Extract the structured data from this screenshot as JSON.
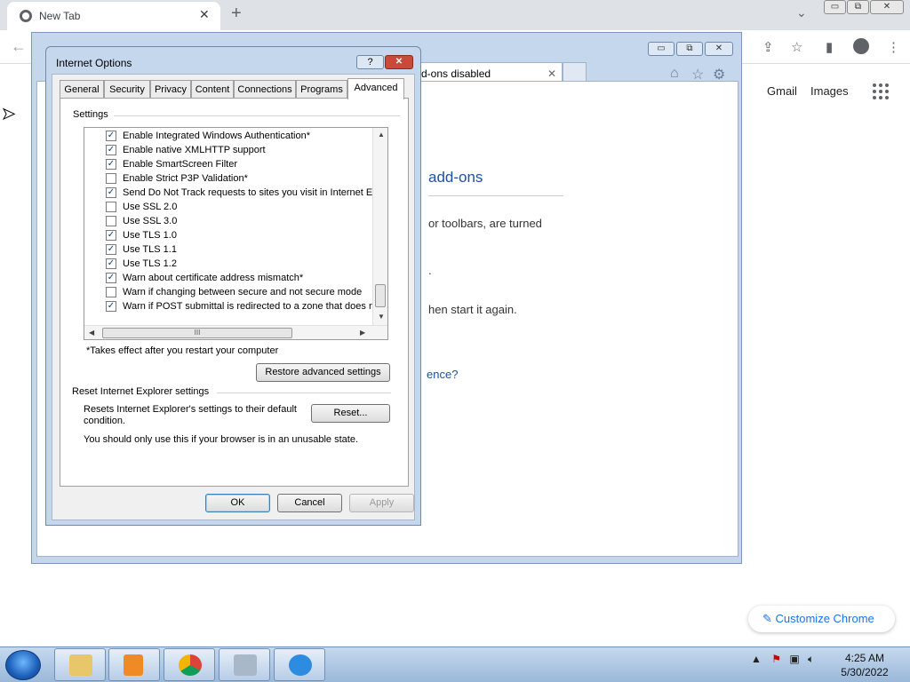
{
  "chrome": {
    "tab_title": "New Tab",
    "tab_close": "✕",
    "new_tab": "+",
    "gmail": "Gmail",
    "images": "Images",
    "customize": "Customize Chrome",
    "win_min": "▭",
    "win_max": "⧉",
    "win_close": "✕"
  },
  "ie": {
    "tab_title": "d-ons disabled",
    "tab_close": "✕",
    "heading": "add-ons",
    "line1": "or toolbars, are turned",
    "line2": ".",
    "line3": "hen start it again.",
    "link": "ence?"
  },
  "dialog": {
    "title": "Internet Options",
    "help": "?",
    "close": "✕",
    "tabs": [
      "General",
      "Security",
      "Privacy",
      "Content",
      "Connections",
      "Programs",
      "Advanced"
    ],
    "active_tab": "Advanced",
    "settings_label": "Settings",
    "items": [
      {
        "label": "Enable Integrated Windows Authentication*",
        "checked": true
      },
      {
        "label": "Enable native XMLHTTP support",
        "checked": true
      },
      {
        "label": "Enable SmartScreen Filter",
        "checked": true
      },
      {
        "label": "Enable Strict P3P Validation*",
        "checked": false
      },
      {
        "label": "Send Do Not Track requests to sites you visit in Internet E",
        "checked": true
      },
      {
        "label": "Use SSL 2.0",
        "checked": false
      },
      {
        "label": "Use SSL 3.0",
        "checked": false
      },
      {
        "label": "Use TLS 1.0",
        "checked": true
      },
      {
        "label": "Use TLS 1.1",
        "checked": true
      },
      {
        "label": "Use TLS 1.2",
        "checked": true
      },
      {
        "label": "Warn about certificate address mismatch*",
        "checked": true
      },
      {
        "label": "Warn if changing between secure and not secure mode",
        "checked": false
      },
      {
        "label": "Warn if POST submittal is redirected to a zone that does n",
        "checked": true
      }
    ],
    "hscroll_grip": "III",
    "restart_note": "*Takes effect after you restart your computer",
    "restore_btn": "Restore advanced settings",
    "reset_group": "Reset Internet Explorer settings",
    "reset_desc": "Resets Internet Explorer's settings to their default condition.",
    "reset_btn": "Reset...",
    "unusable_note": "You should only use this if your browser is in an unusable state.",
    "ok": "OK",
    "cancel": "Cancel",
    "apply": "Apply"
  },
  "taskbar": {
    "time": "4:25 AM",
    "date": "5/30/2022"
  },
  "colors": {
    "accent_link": "#1a73e8",
    "ie_heading": "#1e50a2",
    "dialog_frame": "#c4d7ec"
  }
}
